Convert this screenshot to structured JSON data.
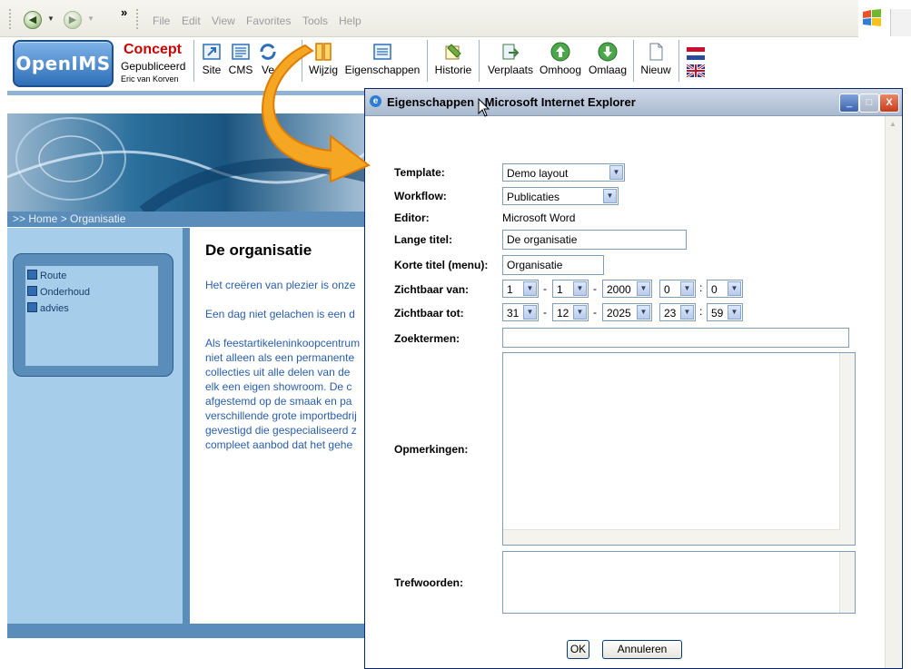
{
  "browser": {
    "menu": [
      "File",
      "Edit",
      "View",
      "Favorites",
      "Tools",
      "Help"
    ],
    "chevron": "»"
  },
  "openims": {
    "logo": "OpenIMS",
    "status": {
      "concept": "Concept",
      "published": "Gepubliceerd",
      "author": "Eric van Korven"
    },
    "tools": [
      {
        "label": "Site",
        "icon": "site-icon"
      },
      {
        "label": "CMS",
        "icon": "cms-icon"
      },
      {
        "label": "Ve",
        "icon": "versions-icon"
      },
      {
        "label": "Wijzig",
        "icon": "edit-icon"
      },
      {
        "label": "Eigenschappen",
        "icon": "properties-icon"
      },
      {
        "label": "Historie",
        "icon": "history-icon"
      },
      {
        "label": "Verplaats",
        "icon": "move-icon"
      },
      {
        "label": "Omhoog",
        "icon": "up-icon"
      },
      {
        "label": "Omlaag",
        "icon": "down-icon"
      },
      {
        "label": "Nieuw",
        "icon": "new-icon"
      }
    ],
    "colors": {
      "accent": "#2f6fb8",
      "concept_red": "#cc0000",
      "highlight": "#f5a623"
    }
  },
  "page": {
    "breadcrumb": ">>  Home > Organisatie",
    "nav": [
      "Route",
      "Onderhoud",
      "advies"
    ],
    "title": "De organisatie",
    "paragraphs": [
      "Het creëren van plezier is onze",
      "Een dag niet gelachen is een d",
      "Als feestartikeleninkoopcentrum",
      "niet alleen als een permanente",
      "collecties uit alle delen van de",
      "elk een eigen showroom. De c",
      "afgestemd op de smaak en pa",
      "verschillende grote importbedrij",
      "gevestigd die gespecialiseerd z",
      "compleet aanbod dat het gehe"
    ]
  },
  "dialog": {
    "title": "Eigenschappen - Microsoft Internet Explorer",
    "labels": {
      "template": "Template:",
      "workflow": "Workflow:",
      "editor": "Editor:",
      "lange_titel": "Lange titel:",
      "korte_titel": "Korte titel (menu):",
      "zichtbaar_van": "Zichtbaar van:",
      "zichtbaar_tot": "Zichtbaar tot:",
      "zoektermen": "Zoektermen:",
      "opmerkingen": "Opmerkingen:",
      "trefwoorden": "Trefwoorden:"
    },
    "values": {
      "template": "Demo layout",
      "workflow": "Publicaties",
      "editor": "Microsoft Word",
      "lange_titel": "De organisatie",
      "korte_titel": "Organisatie",
      "van": {
        "day": "1",
        "month": "1",
        "year": "2000",
        "hour": "0",
        "minute": "0"
      },
      "tot": {
        "day": "31",
        "month": "12",
        "year": "2025",
        "hour": "23",
        "minute": "59"
      },
      "zoektermen": "",
      "opmerkingen": "",
      "trefwoorden": ""
    },
    "buttons": {
      "ok": "OK",
      "cancel": "Annuleren"
    },
    "window_buttons": {
      "minimize": "_",
      "maximize": "□",
      "close": "X"
    }
  }
}
